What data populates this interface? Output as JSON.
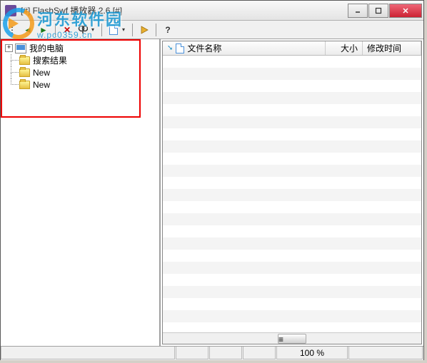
{
  "titlebar": {
    "text": "[#] FlashSwf 播放器 2.6 [#]"
  },
  "tree": {
    "root": {
      "label": "我的电脑",
      "expander": "+"
    },
    "children": [
      {
        "label": "搜索结果"
      },
      {
        "label": "New"
      },
      {
        "label": "New"
      }
    ]
  },
  "list_headers": {
    "filename": "文件名称",
    "size": "大小",
    "mtime": "修改时间"
  },
  "statusbar": {
    "zoom": "100 %"
  },
  "watermark": {
    "cn": "河东软件园",
    "en": "w.pc0359.cn"
  },
  "icons": {
    "back": "←",
    "fwd": "→",
    "stop": "✕",
    "find": "🔍",
    "drop": "▾",
    "new": "📄",
    "play": "▶",
    "help": "?"
  }
}
